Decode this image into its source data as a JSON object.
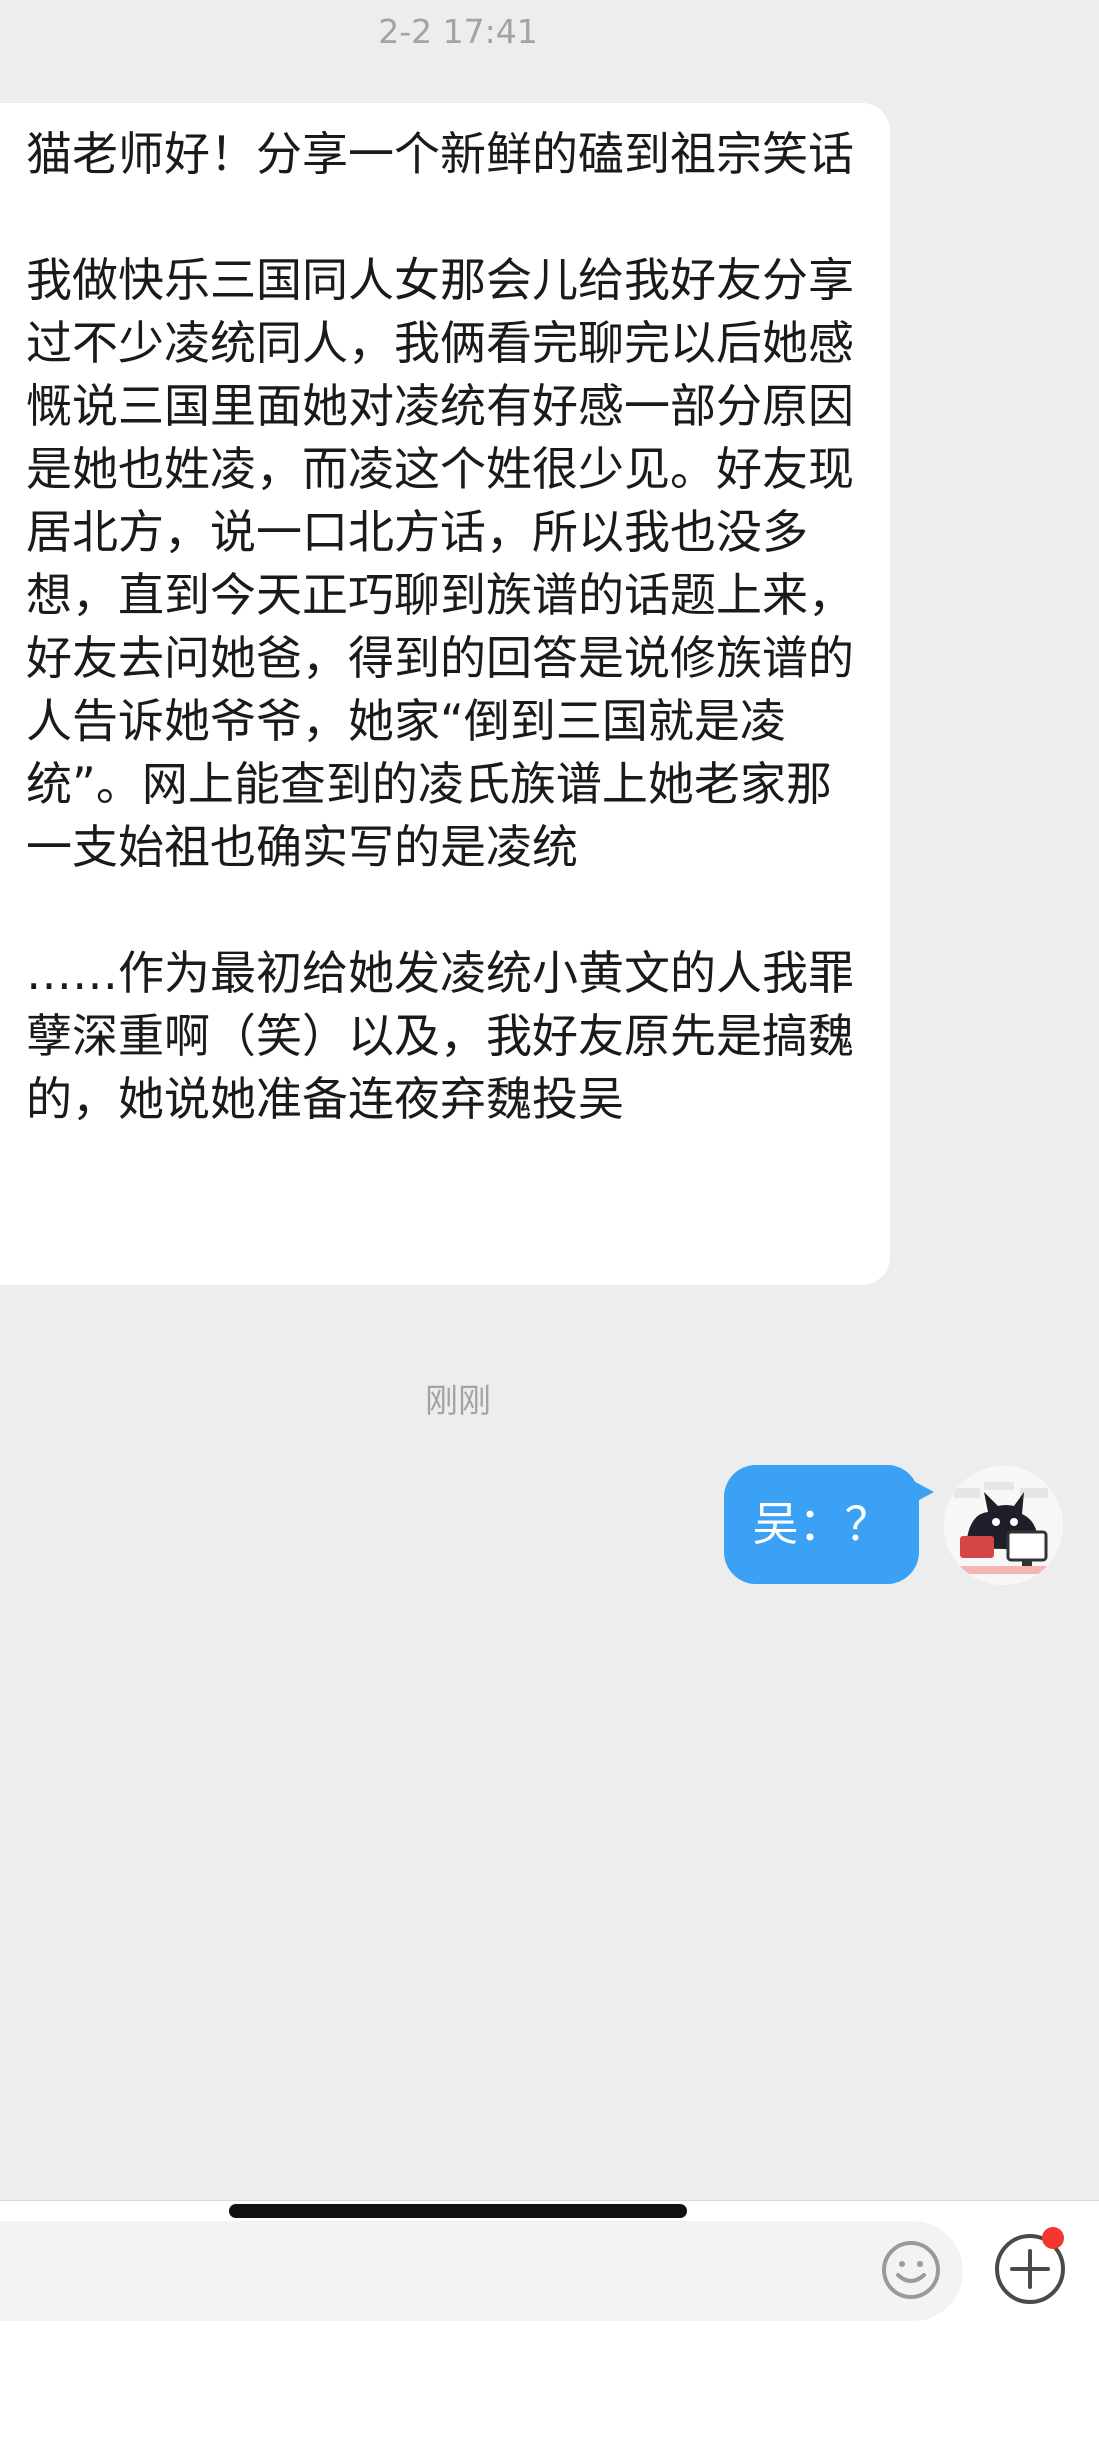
{
  "chat": {
    "messages": [
      {
        "timestamp": "2-2 17:41",
        "sender": "other",
        "text": "猫老师好！分享一个新鲜的磕到祖宗笑话\n\n我做快乐三国同人女那会儿给我好友分享过不少凌统同人，我俩看完聊完以后她感慨说三国里面她对凌统有好感一部分原因是她也姓凌，而凌这个姓很少见。好友现居北方，说一口北方话，所以我也没多想，直到今天正巧聊到族谱的话题上来，好友去问她爸，得到的回答是说修族谱的人告诉她爷爷，她家“倒到三国就是凌统”。网上能查到的凌氏族谱上她老家那一支始祖也确实写的是凌统\n\n……作为最初给她发凌统小黄文的人我罪孽深重啊（笑）以及，我好友原先是搞魏的，她说她准备连夜弃魏投吴"
      },
      {
        "timestamp": "刚刚",
        "sender": "self",
        "text": "吴：？"
      }
    ]
  },
  "input_bar": {
    "placeholder": "",
    "emoji_icon": "emoji-face-icon",
    "plus_icon": "plus-circle-icon",
    "has_notification_dot": true
  },
  "colors": {
    "background": "#ededed",
    "self_bubble": "#3aa1f5",
    "other_bubble": "#ffffff",
    "notification_dot": "#f43530"
  }
}
